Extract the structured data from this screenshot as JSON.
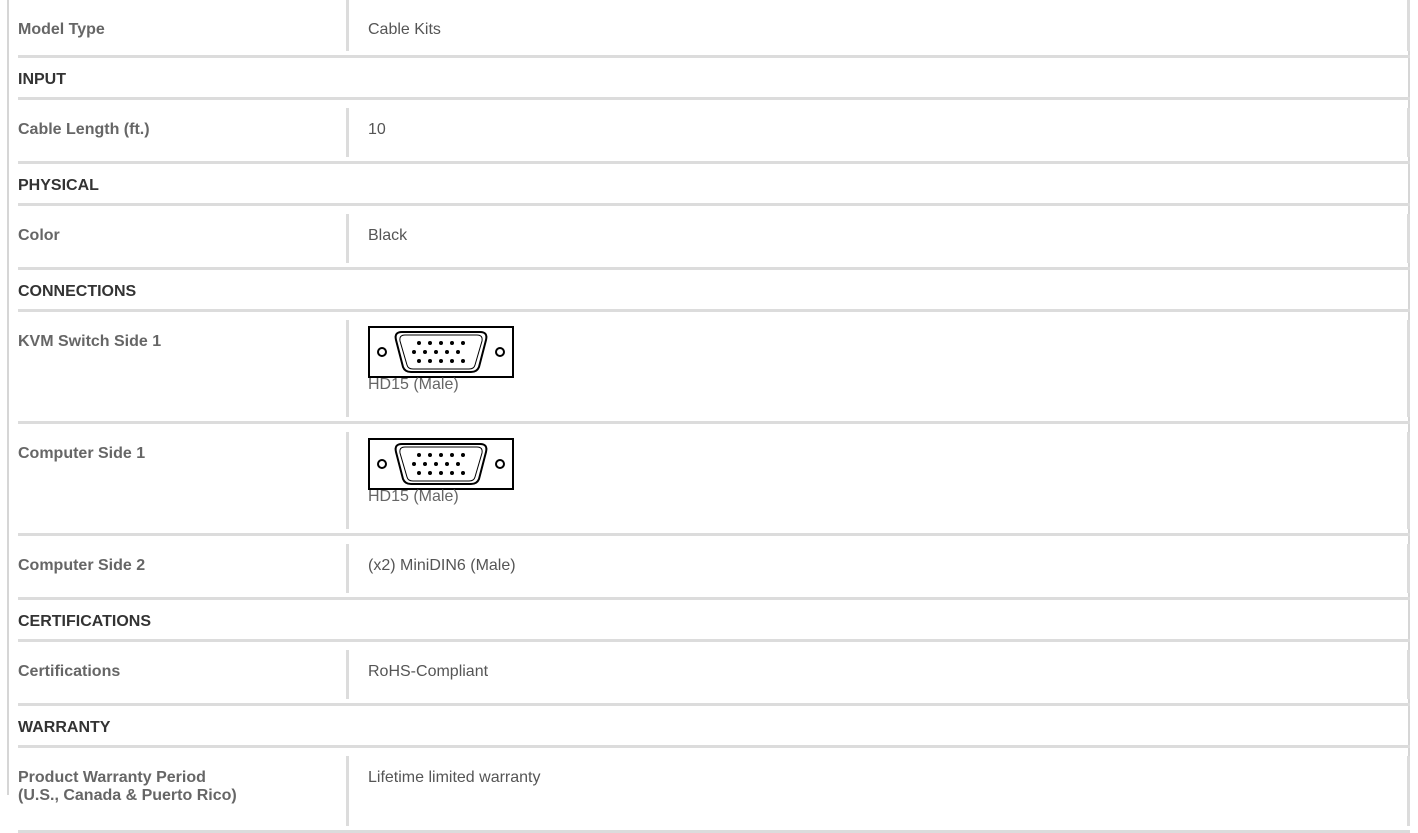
{
  "rows": [
    {
      "type": "row",
      "label": "Model Type",
      "value": "Cable Kits"
    },
    {
      "type": "section",
      "title": "INPUT"
    },
    {
      "type": "row",
      "label": "Cable Length (ft.)",
      "value": "10"
    },
    {
      "type": "section",
      "title": "PHYSICAL"
    },
    {
      "type": "row",
      "label": "Color",
      "value": "Black"
    },
    {
      "type": "section",
      "title": "CONNECTIONS"
    },
    {
      "type": "connector",
      "label": "KVM Switch Side 1",
      "icon": "hd15-connector-icon",
      "caption": "HD15 (Male)"
    },
    {
      "type": "connector",
      "label": "Computer Side 1",
      "icon": "hd15-connector-icon",
      "caption": "HD15 (Male)"
    },
    {
      "type": "row",
      "label": "Computer Side 2",
      "value": "(x2) MiniDIN6 (Male)"
    },
    {
      "type": "section",
      "title": "CERTIFICATIONS"
    },
    {
      "type": "row",
      "label": "Certifications",
      "value": "RoHS-Compliant"
    },
    {
      "type": "section",
      "title": "WARRANTY"
    },
    {
      "type": "warranty",
      "label_line1": "Product Warranty Period",
      "label_line2": "(U.S., Canada & Puerto Rico)",
      "value": "Lifetime limited warranty"
    }
  ],
  "colors": {
    "border": "#dcdcdc",
    "label_text": "#666666",
    "value_text": "#555555",
    "section_text": "#333333"
  }
}
